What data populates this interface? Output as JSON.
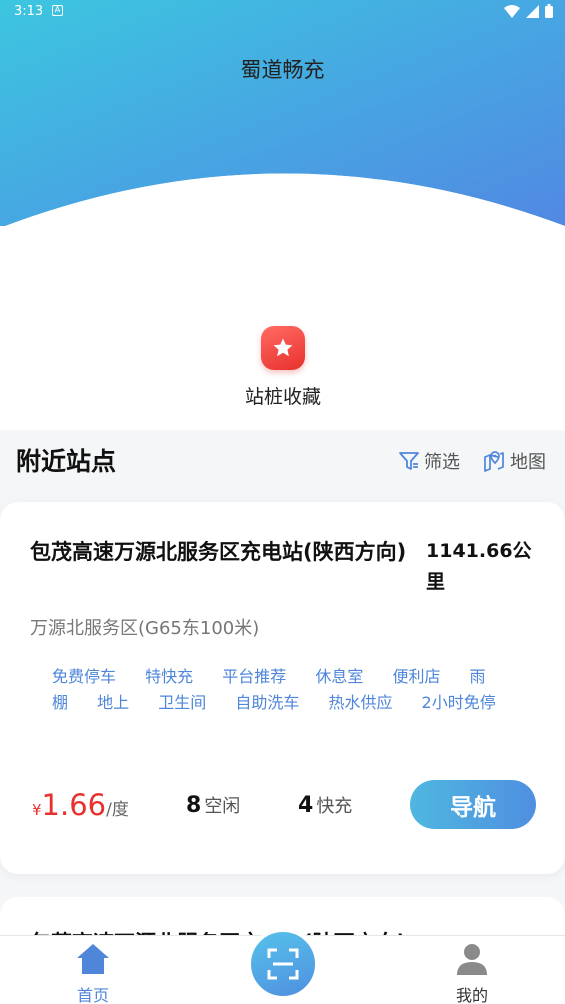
{
  "status_bar": {
    "time": "3:13"
  },
  "header": {
    "title": "蜀道畅充"
  },
  "favorites": {
    "label": "站桩收藏"
  },
  "section": {
    "title": "附近站点",
    "filter_label": "筛选",
    "map_label": "地图"
  },
  "station": {
    "name": "包茂高速万源北服务区充电站(陕西方向)",
    "distance": "1141.66公里",
    "subtitle": "万源北服务区(G65东100米)",
    "tags": [
      "免费停车",
      "特快充",
      "平台推荐",
      "休息室",
      "便利店",
      "雨棚",
      "地上",
      "卫生间",
      "自助洗车",
      "热水供应",
      "2小时免停"
    ],
    "price_currency": "¥",
    "price": "1.66",
    "price_unit": "/度",
    "free_count": "8",
    "free_label": "空闲",
    "fast_count": "4",
    "fast_label": "快充",
    "nav_label": "导航"
  },
  "station2": {
    "name_partial": "包茂高速万源北服务区充电站(陕西方向)"
  },
  "tabbar": {
    "home_label": "首页",
    "mine_label": "我的"
  },
  "colors": {
    "accent_blue": "#4f86d9",
    "price_red": "#e8312e",
    "header_gradient_start": "#3cc6e0",
    "header_gradient_end": "#5188e3"
  },
  "icons": {
    "favorite": "star-icon",
    "filter": "filter-icon",
    "map": "map-pin-icon",
    "home": "home-icon",
    "scan": "scan-icon",
    "mine": "user-icon"
  }
}
